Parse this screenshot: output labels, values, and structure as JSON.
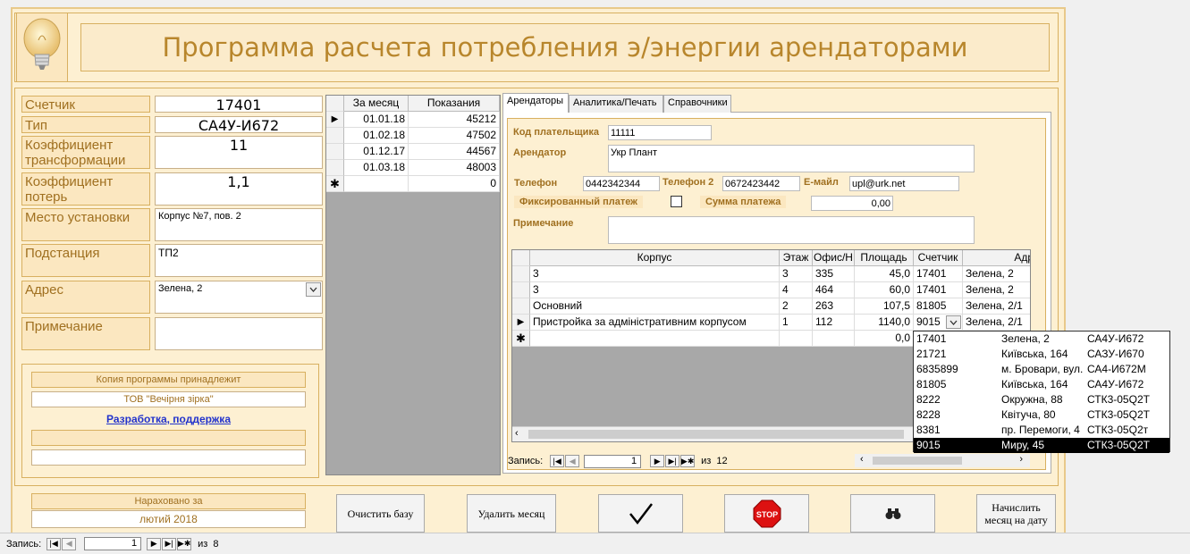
{
  "header": {
    "title": "Программа расчета потребления э/энергии арендаторами"
  },
  "meter_fields": [
    {
      "label": "Счетчик",
      "value": "17401"
    },
    {
      "label": "Тип",
      "value": "СА4У-И672"
    },
    {
      "label": "Коэффициент трансформации",
      "value": "11"
    },
    {
      "label": "Коэффициент потерь",
      "value": "1,1"
    },
    {
      "label": "Место установки",
      "value": "Корпус №7, пов. 2"
    },
    {
      "label": "Подстанция",
      "value": "ТП2"
    },
    {
      "label": "Адрес",
      "value": "Зелена, 2"
    },
    {
      "label": "Примечание",
      "value": ""
    }
  ],
  "owner": {
    "title": "Копия программы принадлежит",
    "name": "ТОВ \"Вечірня зірка\"",
    "support_link": "Разработка, поддержка"
  },
  "accrued": {
    "title": "Нараховано за",
    "period": "лютий 2018"
  },
  "readings": {
    "headers": [
      "За месяц",
      "Показания"
    ],
    "rows": [
      [
        "01.01.18",
        "45212"
      ],
      [
        "01.02.18",
        "47502"
      ],
      [
        "01.12.17",
        "44567"
      ],
      [
        "01.03.18",
        "48003"
      ]
    ],
    "new_row_value": "0"
  },
  "tabs": [
    "Арендаторы",
    "Аналитика/Печать",
    "Справочники"
  ],
  "tenant": {
    "payer_code_label": "Код плательщика",
    "payer_code": "11111",
    "tenant_label": "Арендатор",
    "tenant": "Укр Плант",
    "phone_label": "Телефон",
    "phone": "0442342344",
    "phone2_label": "Телефон 2",
    "phone2": "0672423442",
    "email_label": "Е-майл",
    "email": "upl@urk.net",
    "fixed_label": "Фиксированный платеж",
    "sum_label": "Сумма платежа",
    "sum": "0,00",
    "note_label": "Примечание",
    "note": ""
  },
  "premises": {
    "headers": [
      "Корпус",
      "Этаж",
      "Офис/Н",
      "Площадь",
      "Счетчик",
      "Адр"
    ],
    "rows": [
      [
        "3",
        "3",
        "335",
        "45,0",
        "17401",
        "Зелена, 2"
      ],
      [
        "3",
        "4",
        "464",
        "60,0",
        "17401",
        "Зелена, 2"
      ],
      [
        "Основний",
        "2",
        "263",
        "107,5",
        "81805",
        "Зелена, 2/1"
      ],
      [
        "Пристройка за адміністративним корпусом",
        "1",
        "112",
        "1140,0",
        "9015",
        "Зелена, 2/1"
      ]
    ],
    "new_row_area": "0,0"
  },
  "meter_dropdown": [
    [
      "17401",
      "Зелена, 2",
      "СА4У-И672"
    ],
    [
      "21721",
      "Київська, 164",
      "САЗУ-И670"
    ],
    [
      "6835899",
      "м. Бровари, вул.",
      "СА4-И672М"
    ],
    [
      "81805",
      "Київська, 164",
      "СА4У-И672"
    ],
    [
      "8222",
      "Окружна, 88",
      "СТК3-05Q2Т"
    ],
    [
      "8228",
      "Квітуча, 80",
      "СТК3-05Q2Т"
    ],
    [
      "8381",
      "пр. Перемоги, 4",
      "СТК3-05Q2т"
    ],
    [
      "9015",
      "Миру, 45",
      "СТК3-05Q2Т"
    ]
  ],
  "sub_nav": {
    "label": "Запись:",
    "current": "1",
    "of": "из",
    "total": "12"
  },
  "buttons": {
    "clear_db": "Очистить базу",
    "delete_month": "Удалить месяц",
    "stop": "STOP",
    "recalc": "Начислить месяц на дату"
  },
  "main_nav": {
    "label": "Запись:",
    "current": "1",
    "of": "из",
    "total": "8"
  }
}
